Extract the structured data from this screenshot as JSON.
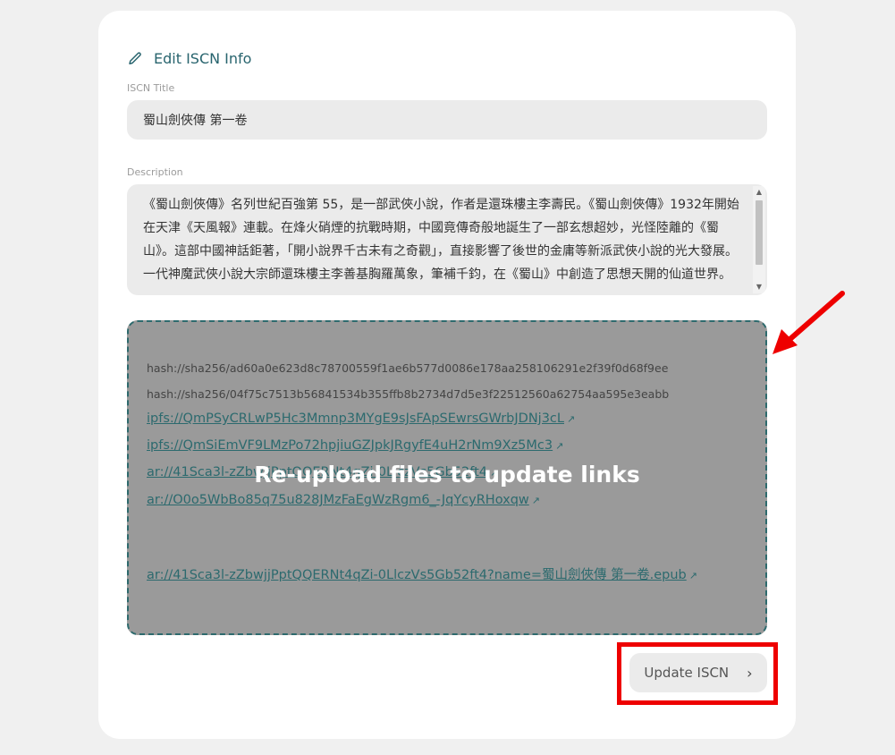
{
  "header": {
    "title": "Edit ISCN Info",
    "icon": "pencil-icon"
  },
  "iscn_title": {
    "label": "ISCN Title",
    "value": "蜀山劍俠傳 第一卷"
  },
  "description": {
    "label": "Description",
    "value": "《蜀山劍俠傳》名列世紀百強第 55，是一部武俠小說，作者是還珠樓主李壽民。《蜀山劍俠傳》1932年開始在天津《天風報》連載。在烽火硝煙的抗戰時期，中國竟傳奇般地誕生了一部玄想超妙，光怪陸離的《蜀山》。這部中國神話鉅著，「開小說界千古未有之奇觀」，直接影響了後世的金庸等新派武俠小說的光大發展。 一代神魔武俠小說大宗師還珠樓主李善基胸羅萬象，筆補千鈞，在《蜀山》中創造了思想天開的仙道世界。"
  },
  "files": {
    "hashes": [
      "hash://sha256/ad60a0e623d8c78700559f1ae6b577d0086e178aa258106291e2f39f0d68f9ee",
      "hash://sha256/04f75c7513b56841534b355ffb8b2734d7d5e3f22512560a62754aa595e3eabb"
    ],
    "links": [
      "ipfs://QmPSyCRLwP5Hc3Mmnp3MYgE9sJsFApSEwrsGWrbJDNj3cL",
      "ipfs://QmSiEmVF9LMzPo72hpjiuGZJpkJRgyfE4uH2rNm9Xz5Mc3",
      "ar://41Sca3l-zZbwjjPptQQERNt4qZi-0LlczVs5Gb52ft4",
      "ar://O0o5WbBo85q75u828JMzFaEgWzRgm6_-JqYcyRHoxqw"
    ],
    "epub_link": "ar://41Sca3l-zZbwjjPptQQERNt4qZi-0LlczVs5Gb52ft4?name=蜀山劍俠傳 第一卷.epub",
    "overlay_message": "Re-upload files to update links"
  },
  "actions": {
    "update_label": "Update ISCN"
  },
  "colors": {
    "accent": "#28646e",
    "annotation": "#ee0000"
  }
}
